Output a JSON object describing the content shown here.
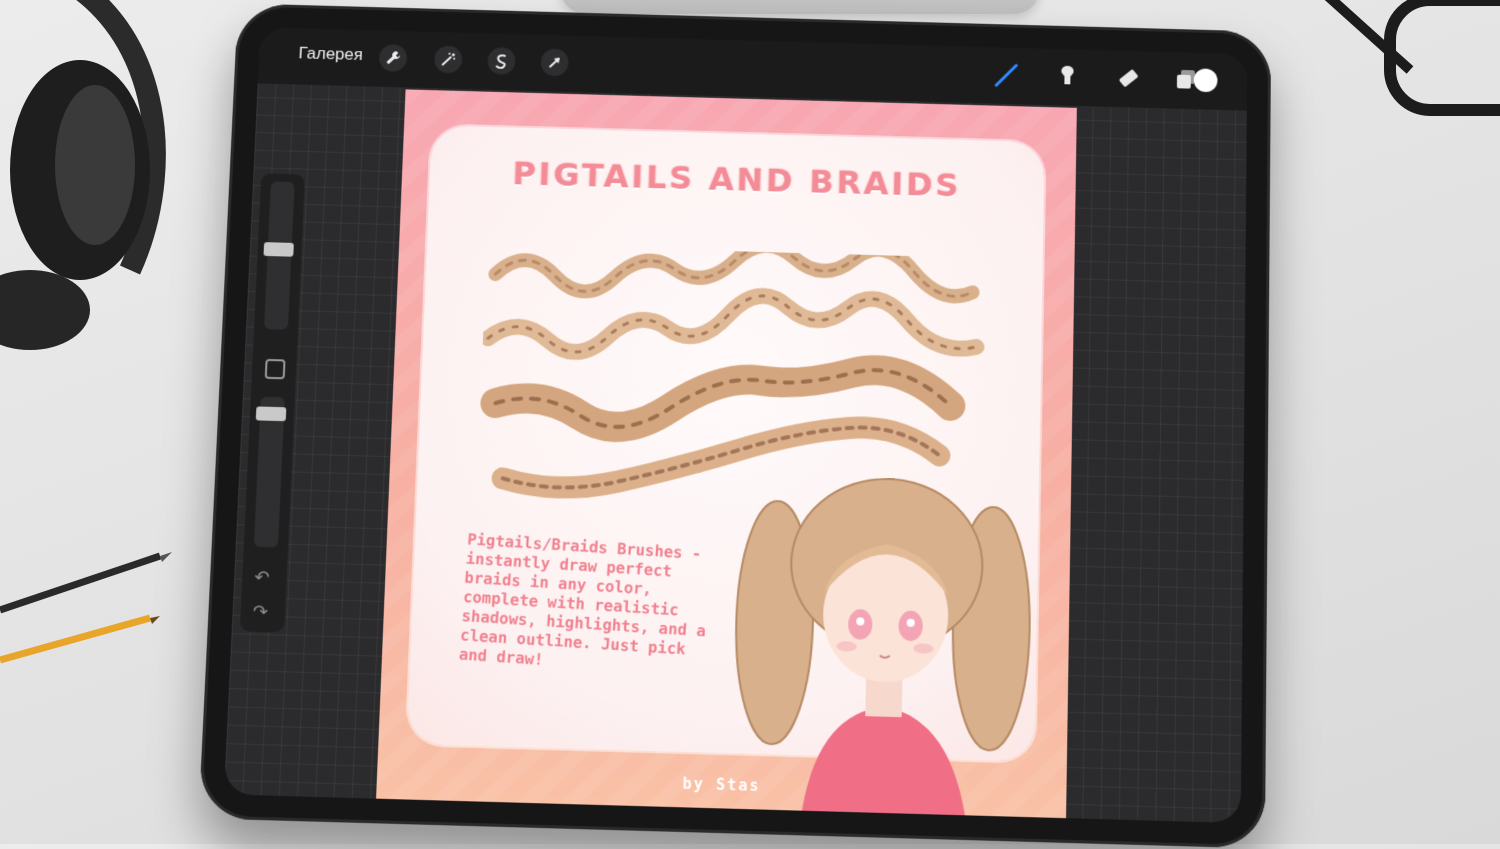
{
  "toolbar": {
    "gallery_label": "Галерея",
    "actions": [
      {
        "name": "wrench-icon",
        "glyph": "🔧"
      },
      {
        "name": "magic-wand-icon",
        "glyph": "✨"
      },
      {
        "name": "selection-icon",
        "glyph": "S"
      },
      {
        "name": "move-arrow-icon",
        "glyph": "➚"
      }
    ],
    "tools": [
      "brush-icon",
      "smudge-icon",
      "eraser-icon",
      "layers-icon"
    ],
    "current_color": "#ffffff",
    "active_tool_color": "#2f8bff"
  },
  "artwork": {
    "title": "PIGTAILS AND BRAIDS",
    "description": "Pigtails/Braids Brushes - instantly draw perfect braids in any color, complete with realistic shadows, highlights, and a clean outline. Just pick and draw!",
    "signature": "by Stas",
    "accent_color": "#f48c98",
    "hair_color": "#d9b08c"
  }
}
